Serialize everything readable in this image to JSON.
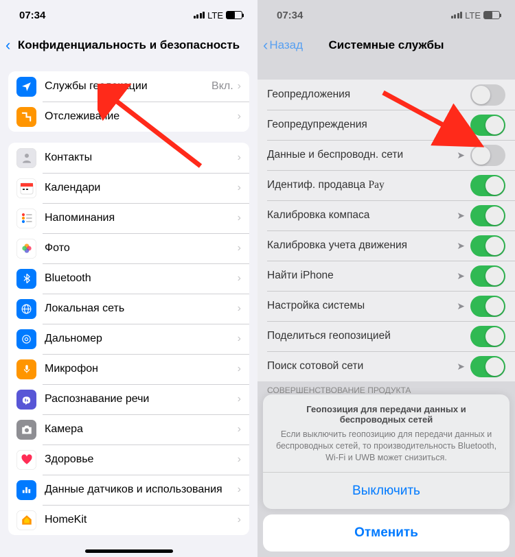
{
  "status": {
    "time": "07:34",
    "network": "LTE"
  },
  "left": {
    "back": "",
    "title": "Конфиденциальность и безопасность",
    "group1": [
      {
        "icon": "location",
        "bg": "#007aff",
        "label": "Службы геолокации",
        "value": "Вкл."
      },
      {
        "icon": "tracking",
        "bg": "#ff9500",
        "label": "Отслеживание",
        "value": ""
      }
    ],
    "group2": [
      {
        "icon": "contacts",
        "bg": "#e5e5ea",
        "label": "Контакты"
      },
      {
        "icon": "calendar",
        "bg": "#ffffff",
        "label": "Календари"
      },
      {
        "icon": "reminders",
        "bg": "#ffffff",
        "label": "Напоминания"
      },
      {
        "icon": "photos",
        "bg": "#ffffff",
        "label": "Фото"
      },
      {
        "icon": "bluetooth",
        "bg": "#007aff",
        "label": "Bluetooth"
      },
      {
        "icon": "localnet",
        "bg": "#007aff",
        "label": "Локальная сеть"
      },
      {
        "icon": "measure",
        "bg": "#007aff",
        "label": "Дальномер"
      },
      {
        "icon": "mic",
        "bg": "#ff9500",
        "label": "Микрофон"
      },
      {
        "icon": "speech",
        "bg": "#5856d6",
        "label": "Распознавание речи"
      },
      {
        "icon": "camera",
        "bg": "#8e8e93",
        "label": "Камера"
      },
      {
        "icon": "health",
        "bg": "#ffffff",
        "label": "Здоровье"
      },
      {
        "icon": "sensors",
        "bg": "#007aff",
        "label": "Данные датчиков и использования"
      },
      {
        "icon": "homekit",
        "bg": "#ffffff",
        "label": "HomeKit"
      }
    ]
  },
  "right": {
    "back": "Назад",
    "title": "Системные службы",
    "rows": [
      {
        "label": "Геопредложения",
        "arrow": "",
        "on": false
      },
      {
        "label": "Геопредупреждения",
        "arrow": "purple",
        "on": true
      },
      {
        "label": "Данные и беспроводн. сети",
        "arrow": "gray",
        "on": false
      },
      {
        "label": "Идентиф. продавца Pay",
        "apple": true,
        "arrow": "",
        "on": true
      },
      {
        "label": "Калибровка компаса",
        "arrow": "gray",
        "on": true
      },
      {
        "label": "Калибровка учета движения",
        "arrow": "gray",
        "on": true
      },
      {
        "label": "Найти iPhone",
        "arrow": "gray",
        "on": true
      },
      {
        "label": "Настройка системы",
        "arrow": "gray",
        "on": true
      },
      {
        "label": "Поделиться геопозицией",
        "arrow": "",
        "on": true
      },
      {
        "label": "Поиск сотовой сети",
        "arrow": "gray",
        "on": true
      }
    ],
    "section_footer": "СОВЕРШЕНСТВОВАНИЕ ПРОДУКТА",
    "alert": {
      "title": "Геопозиция для передачи данных и беспроводных сетей",
      "message": "Если выключить геопозицию для передачи данных и беспроводных сетей, то производительность Bluetooth, Wi-Fi и UWB может снизиться.",
      "action": "Выключить",
      "cancel": "Отменить"
    }
  }
}
